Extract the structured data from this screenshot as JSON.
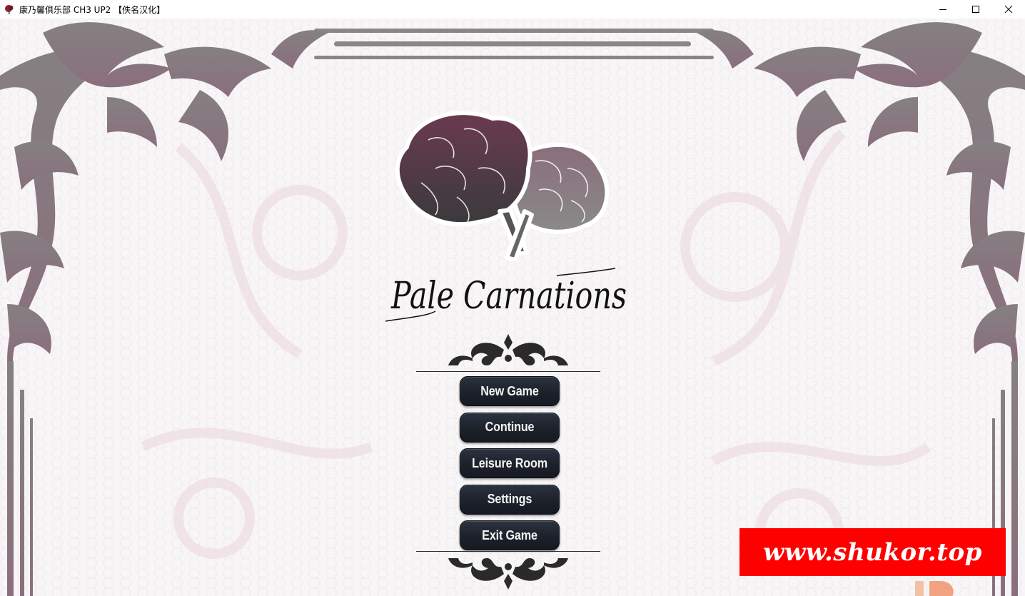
{
  "window": {
    "title": "康乃馨俱乐部 CH3 UP2 【佚名汉化】",
    "controls": {
      "minimize_icon": "minimize-icon",
      "maximize_icon": "maximize-icon",
      "close_icon": "close-icon"
    }
  },
  "game": {
    "title": "Pale Carnations",
    "logo_icon": "carnation-flower-icon"
  },
  "menu": {
    "items": [
      {
        "label": "New Game"
      },
      {
        "label": "Continue"
      },
      {
        "label": "Leisure Room"
      },
      {
        "label": "Settings"
      },
      {
        "label": "Exit Game"
      }
    ]
  },
  "watermark": {
    "text": "www.shukor.top"
  },
  "colors": {
    "button_bg": "#1b2029",
    "button_text": "#f2f2f2",
    "frame": "#7a7478",
    "flower_dark": "#5a3344",
    "flower_light": "#8a8588",
    "watermark_bg": "#ff0000"
  }
}
